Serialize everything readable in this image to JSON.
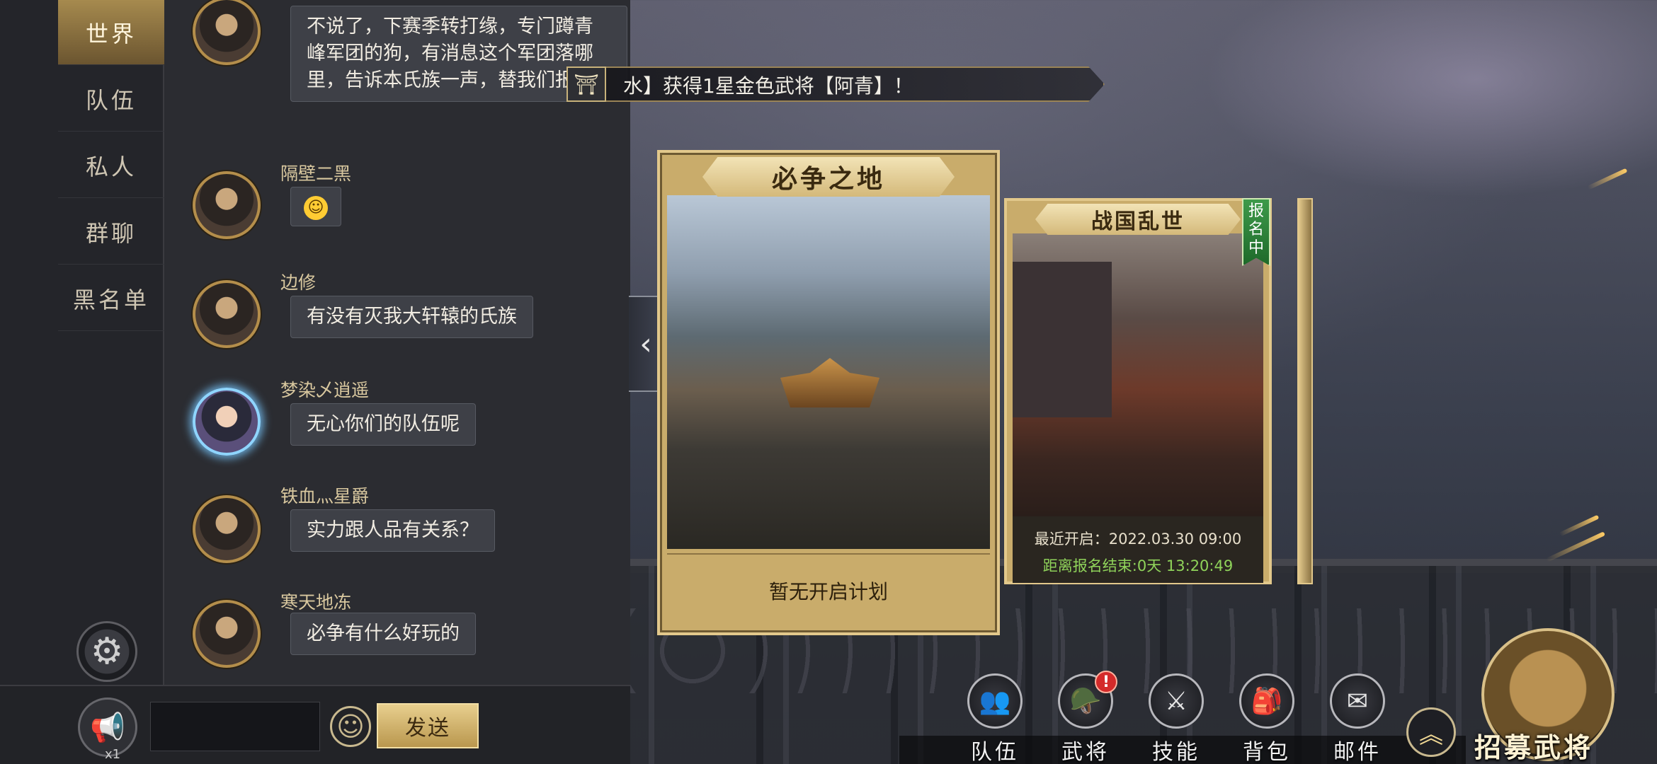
{
  "tabs": [
    {
      "label": "世界",
      "active": true
    },
    {
      "label": "队伍",
      "active": false
    },
    {
      "label": "私人",
      "active": false
    },
    {
      "label": "群聊",
      "active": false
    },
    {
      "label": "黑名单",
      "active": false
    }
  ],
  "messages": [
    {
      "name": "",
      "text": "不说了，下赛季转打缘，专门蹲青峰军团的狗，有消息这个军团落哪里，告诉本氏族一声，替我们报仇"
    },
    {
      "name": "隔壁二黑",
      "text": "😊"
    },
    {
      "name": "边修",
      "text": "有没有灭我大轩辕的氏族"
    },
    {
      "name": "梦染乄逍遥",
      "text": "无心你们的队伍呢"
    },
    {
      "name": "铁血灬星爵",
      "text": "实力跟人品有关系？"
    },
    {
      "name": "寒天地冻",
      "text": "必争有什么好玩的"
    }
  ],
  "input": {
    "placeholder": "",
    "send_label": "发送",
    "horn_count": "x1"
  },
  "banner": {
    "text": "水】获得1星金色武将【阿青】！"
  },
  "cards": {
    "main": {
      "title": "必争之地",
      "footer": "暂无开启计划"
    },
    "secondary": {
      "title": "战国乱世",
      "badge": "报名中",
      "recent_open": "最近开启：2022.03.30 09:00",
      "countdown": "距离报名结束:0天 13:20:49"
    }
  },
  "nav": [
    {
      "label": "队伍",
      "icon": "team-icon"
    },
    {
      "label": "武将",
      "icon": "general-icon",
      "alert": "!"
    },
    {
      "label": "技能",
      "icon": "skill-icon"
    },
    {
      "label": "背包",
      "icon": "bag-icon"
    },
    {
      "label": "邮件",
      "icon": "mail-icon"
    }
  ],
  "recruit": {
    "label": "招募武将"
  },
  "colors": {
    "accent_gold": "#c9ac6b",
    "countdown_green": "#8fd35a",
    "alert_red": "#d42a2a"
  }
}
